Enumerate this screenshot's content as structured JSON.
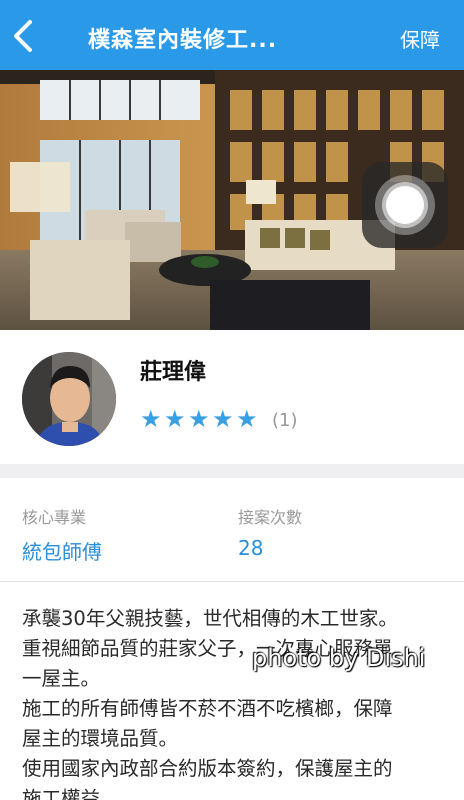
{
  "header": {
    "title": "樸森室內裝修工...",
    "right_label": "保障"
  },
  "carousel": {
    "page_count": 5,
    "active_index": 0
  },
  "profile": {
    "name": "莊理偉",
    "rating": 5,
    "review_count": "(1)"
  },
  "stats": {
    "specialty_label": "核心專業",
    "specialty_value": "統包師傅",
    "jobs_label": "接案次數",
    "jobs_value": "28"
  },
  "description": {
    "lines": [
      "承襲30年父親技藝，世代相傳的木工世家。",
      "重視細節品質的莊家父子，一次專心服務單",
      "一屋主。",
      "施工的所有師傅皆不菸不酒不吃檳榔，保障",
      "屋主的環境品質。",
      "使用國家內政部合約版本簽約，保護屋主的",
      "施工權益。"
    ]
  },
  "watermark": "photo by Dishi",
  "colors": {
    "accent": "#2a9ae8",
    "link": "#2a8fd8",
    "star": "#3b9fe6"
  }
}
